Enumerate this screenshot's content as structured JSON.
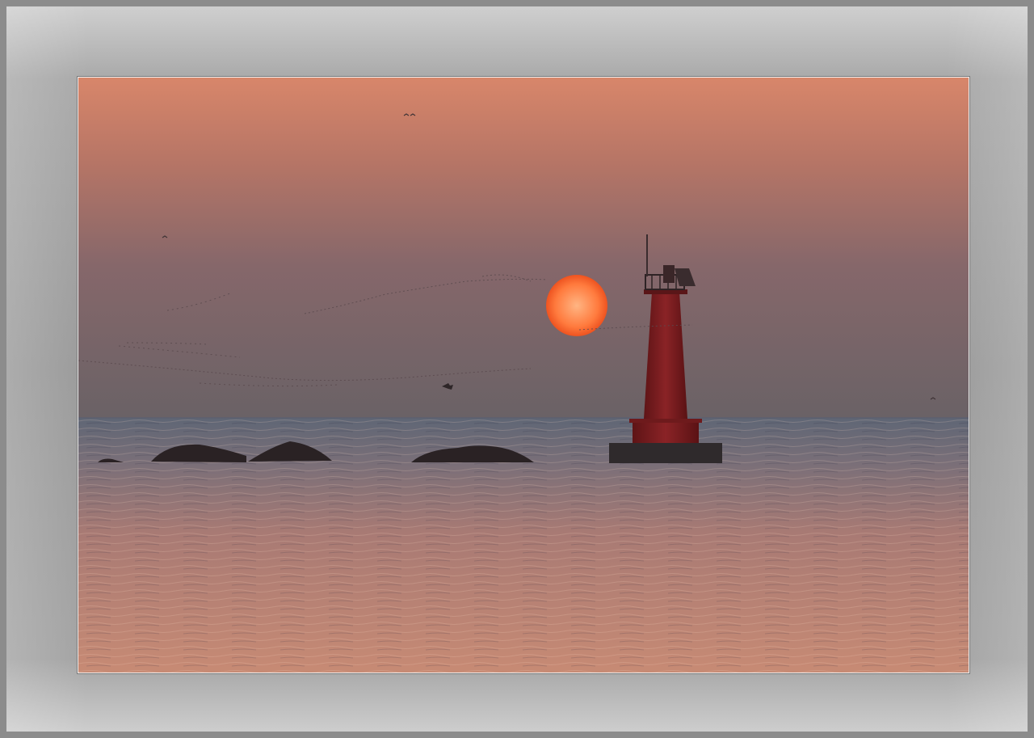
{
  "scene": {
    "subject": "lighthouse",
    "colors": {
      "frame": "#9d9d9d",
      "sky_top": "#d8866a",
      "sky_mid": "#8c6a66",
      "sky_horizon": "#6e6264",
      "sun_center": "#ffb07a",
      "sun_edge": "#f0551e",
      "sea_near": "#c98a74",
      "sea_far": "#666a75",
      "lighthouse": "#7a1c1f",
      "silhouette": "#2a2224"
    },
    "icons": [
      "sun-icon",
      "lighthouse-icon",
      "rock-icon",
      "bird-icon"
    ]
  }
}
